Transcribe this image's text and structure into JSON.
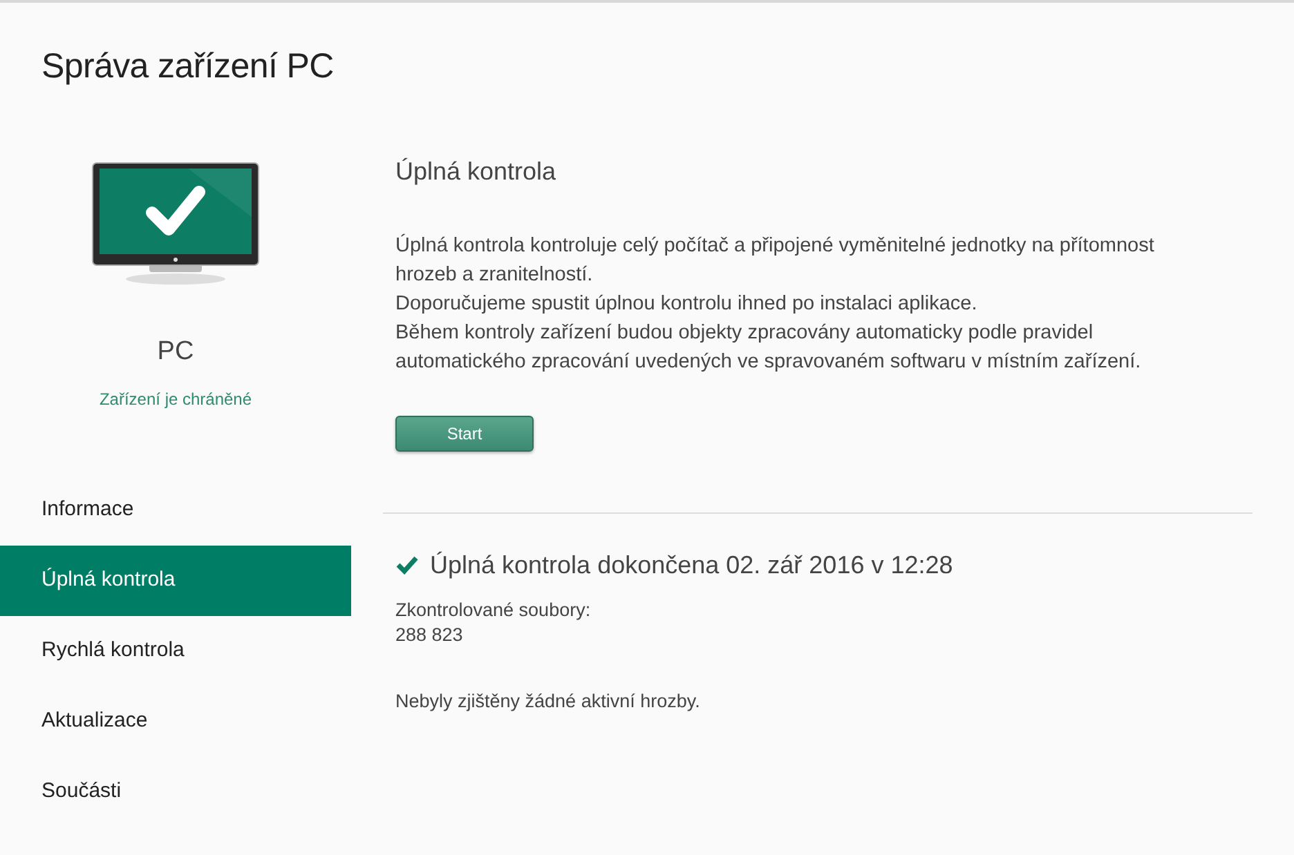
{
  "title": "Správa zařízení PC",
  "device": {
    "name": "PC",
    "status": "Zařízení je chráněné",
    "protected": true
  },
  "nav": [
    {
      "label": "Informace",
      "selected": false
    },
    {
      "label": "Úplná kontrola",
      "selected": true
    },
    {
      "label": "Rychlá kontrola",
      "selected": false
    },
    {
      "label": "Aktualizace",
      "selected": false
    },
    {
      "label": "Součásti",
      "selected": false
    }
  ],
  "panel": {
    "heading": "Úplná kontrola",
    "description": [
      "Úplná kontrola kontroluje celý počítač a připojené vyměnitelné jednotky na přítomnost hrozeb a zranitelností.",
      "Doporučujeme spustit úplnou kontrolu ihned po instalaci aplikace.",
      "Během kontroly zařízení budou objekty zpracovány automaticky podle pravidel automatického zpracování uvedených ve spravovaném softwaru v místním zařízení."
    ],
    "button": "Start"
  },
  "result": {
    "completed": true,
    "heading": "Úplná kontrola dokončena 02. zář 2016 v 12:28",
    "files_label": "Zkontrolované soubory:",
    "files_count": "288 823",
    "threats": "Nebyly zjištěny žádné aktivní hrozby."
  }
}
